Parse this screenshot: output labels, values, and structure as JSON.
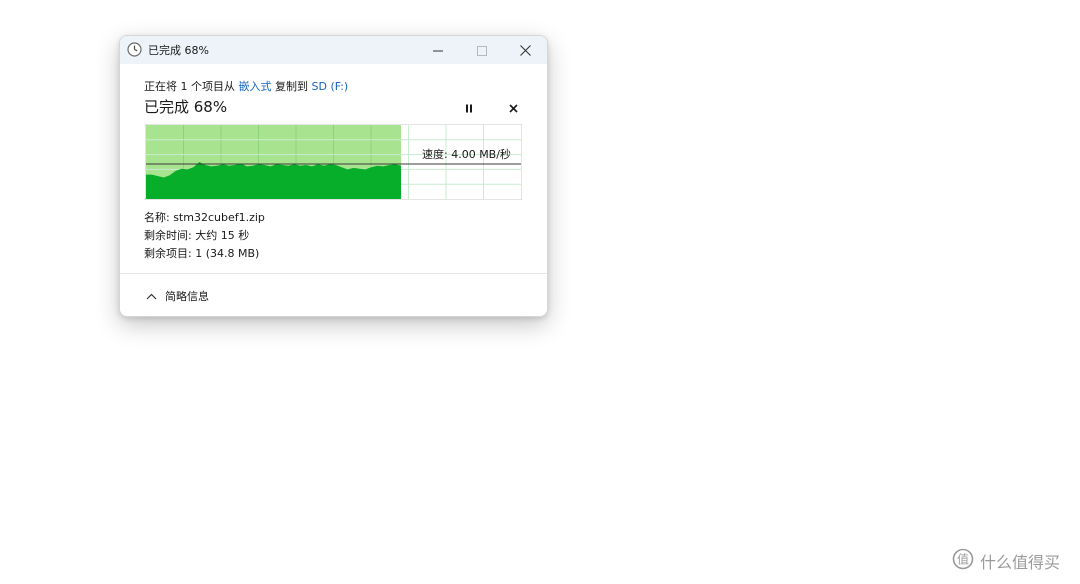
{
  "window": {
    "title": "已完成 68%",
    "clock_icon": "clock-icon",
    "minimize_icon": "minimize-icon",
    "maximize_icon": "maximize-icon",
    "close_icon": "close-icon"
  },
  "copy_info": {
    "prefix": "正在将 1 个项目从",
    "source": "嵌入式",
    "middle": "复制到",
    "destination": "SD (F:)"
  },
  "progress": {
    "title": "已完成 68%",
    "percent": 68,
    "pause_icon": "pause-icon",
    "cancel_icon": "close-icon"
  },
  "graph": {
    "speed_label": "速度: 4.00 MB/秒",
    "filled_color": "#a8e38f",
    "area_color": "#06ae2a",
    "grid_color": "#c8eccf",
    "speed_series": [
      0.33,
      0.33,
      0.31,
      0.29,
      0.32,
      0.38,
      0.41,
      0.4,
      0.43,
      0.5,
      0.46,
      0.44,
      0.45,
      0.47,
      0.45,
      0.46,
      0.48,
      0.44,
      0.45,
      0.47,
      0.46,
      0.44,
      0.47,
      0.46,
      0.45,
      0.47,
      0.45,
      0.46,
      0.44,
      0.47,
      0.45,
      0.47,
      0.46,
      0.43,
      0.4,
      0.42,
      0.41,
      0.4,
      0.43,
      0.45,
      0.44,
      0.46,
      0.47,
      0.45
    ]
  },
  "details": {
    "name_label": "名称: stm32cubef1.zip",
    "time_label": "剩余时间: 大约 15 秒",
    "items_label": "剩余项目: 1 (34.8 MB)"
  },
  "footer": {
    "toggle_label": "简略信息",
    "chevron_icon": "chevron-up-icon"
  },
  "watermark": {
    "text": "什么值得买",
    "logo_icon": "smzdm-logo-icon"
  }
}
